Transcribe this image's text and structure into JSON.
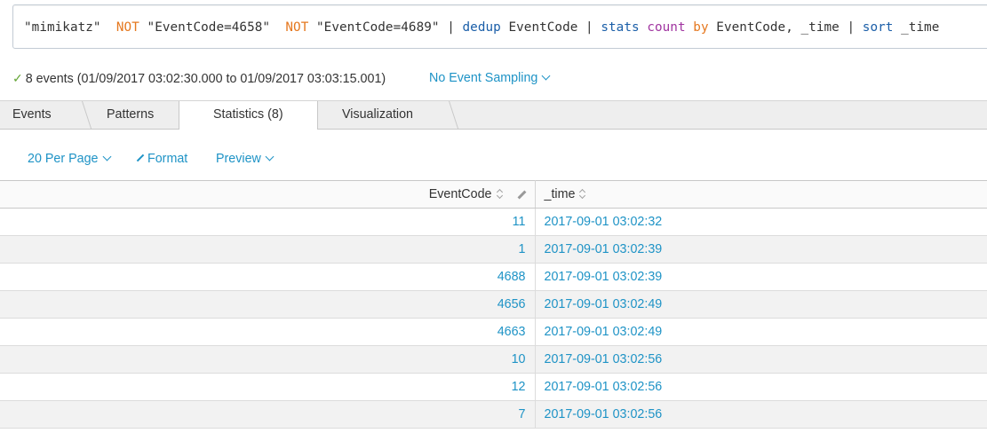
{
  "search": {
    "tokens": [
      {
        "text": "\"mimikatz\"  ",
        "type": "str"
      },
      {
        "text": "NOT",
        "type": "kw"
      },
      {
        "text": " \"EventCode=4658\"  ",
        "type": "str"
      },
      {
        "text": "NOT",
        "type": "kw"
      },
      {
        "text": " \"EventCode=4689\" | ",
        "type": "str"
      },
      {
        "text": "dedup",
        "type": "cmd"
      },
      {
        "text": " EventCode | ",
        "type": "str"
      },
      {
        "text": "stats",
        "type": "cmd"
      },
      {
        "text": " ",
        "type": "str"
      },
      {
        "text": "count",
        "type": "fn"
      },
      {
        "text": " ",
        "type": "str"
      },
      {
        "text": "by",
        "type": "arg"
      },
      {
        "text": " EventCode, _time | ",
        "type": "str"
      },
      {
        "text": "sort",
        "type": "cmd"
      },
      {
        "text": " _time",
        "type": "str"
      }
    ]
  },
  "status": {
    "check_icon": "checkmark-icon",
    "text": "8 events (01/09/2017 03:02:30.000 to 01/09/2017 03:03:15.001)",
    "sampling": "No Event Sampling"
  },
  "tabs": [
    {
      "label": "Events"
    },
    {
      "label": "Patterns"
    },
    {
      "label": "Statistics (8)",
      "active": true
    },
    {
      "label": "Visualization"
    }
  ],
  "toolbar": {
    "per_page": "20 Per Page",
    "format": "Format",
    "preview": "Preview"
  },
  "table": {
    "columns": [
      "EventCode",
      "_time"
    ],
    "rows": [
      [
        "11",
        "2017-09-01 03:02:32"
      ],
      [
        "1",
        "2017-09-01 03:02:39"
      ],
      [
        "4688",
        "2017-09-01 03:02:39"
      ],
      [
        "4656",
        "2017-09-01 03:02:49"
      ],
      [
        "4663",
        "2017-09-01 03:02:49"
      ],
      [
        "10",
        "2017-09-01 03:02:56"
      ],
      [
        "12",
        "2017-09-01 03:02:56"
      ],
      [
        "7",
        "2017-09-01 03:02:56"
      ]
    ]
  },
  "colors": {
    "link": "#1e93c6",
    "keyword": "#e5781f",
    "command": "#1a5ea8",
    "function": "#a034a0",
    "check": "#65a637"
  }
}
